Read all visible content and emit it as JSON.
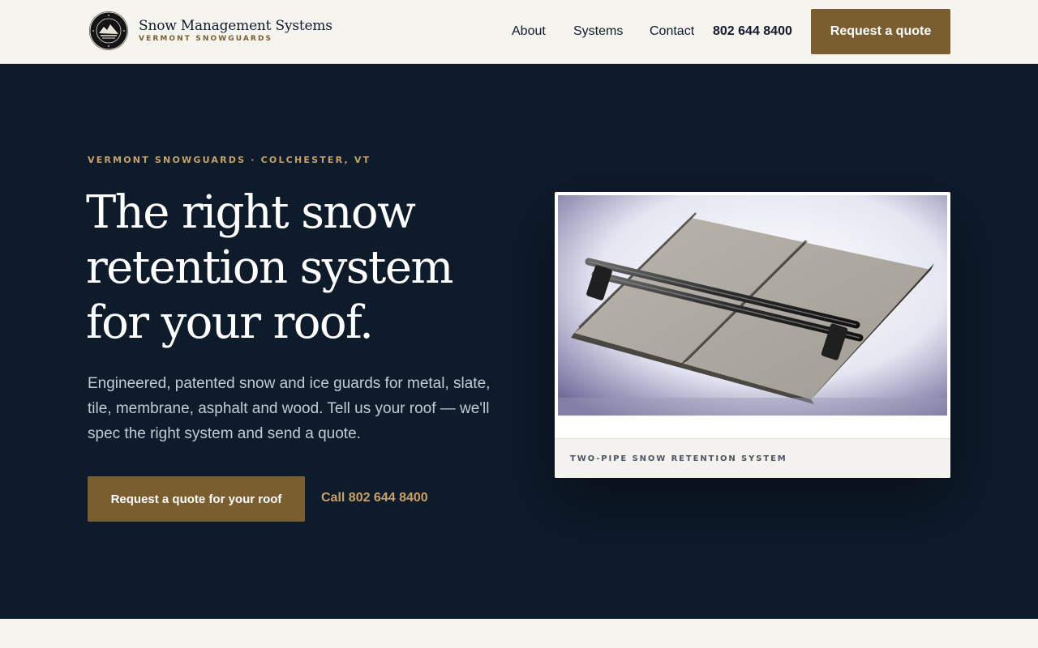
{
  "header": {
    "brand_name": "Snow Management Systems",
    "brand_sub": "VERMONT SNOWGUARDS",
    "nav": [
      {
        "label": "About"
      },
      {
        "label": "Systems"
      },
      {
        "label": "Contact"
      }
    ],
    "phone": "802 644 8400",
    "cta_label": "Request a quote"
  },
  "hero": {
    "eyebrow": "VERMONT SNOWGUARDS · COLCHESTER, VT",
    "headline": "The right snow retention system for your roof.",
    "lede": "Engineered, patented snow and ice guards for metal, slate, tile, membrane, asphalt and wood. Tell us your roof — we'll spec the right system and send a quote.",
    "cta_label": "Request a quote for your roof",
    "call_label": "Call 802 644 8400",
    "figure_caption": "TWO-PIPE SNOW RETENTION SYSTEM"
  },
  "colors": {
    "navy": "#0e1b2b",
    "bronze": "#7a5e30",
    "gold": "#c8a265",
    "cream": "#f6f4ef"
  }
}
